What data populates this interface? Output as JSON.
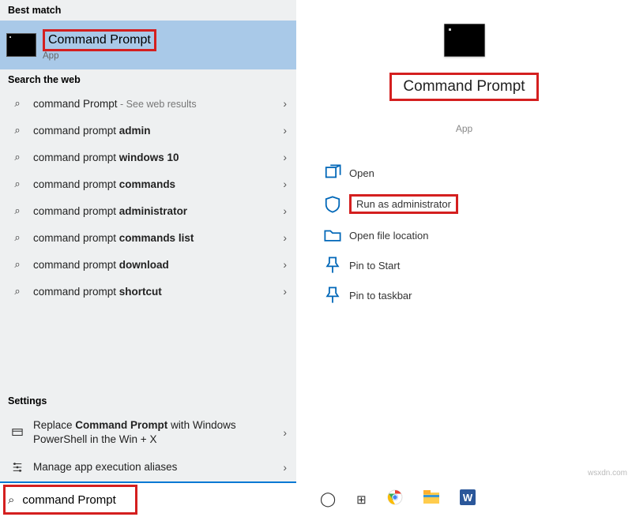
{
  "left": {
    "best_match_header": "Best match",
    "best_match": {
      "title": "Command Prompt",
      "subtitle": "App"
    },
    "web_header": "Search the web",
    "web": [
      {
        "pre": "command Prompt",
        "bold": "",
        "post": "",
        "hint": " - See web results"
      },
      {
        "pre": "command prompt ",
        "bold": "admin",
        "post": "",
        "hint": ""
      },
      {
        "pre": "command prompt ",
        "bold": "windows 10",
        "post": "",
        "hint": ""
      },
      {
        "pre": "command prompt ",
        "bold": "commands",
        "post": "",
        "hint": ""
      },
      {
        "pre": "command prompt ",
        "bold": "administrator",
        "post": "",
        "hint": ""
      },
      {
        "pre": "command prompt ",
        "bold": "commands list",
        "post": "",
        "hint": ""
      },
      {
        "pre": "command prompt ",
        "bold": "download",
        "post": "",
        "hint": ""
      },
      {
        "pre": "command prompt ",
        "bold": "shortcut",
        "post": "",
        "hint": ""
      }
    ],
    "settings_header": "Settings",
    "settings": [
      {
        "pre": "Replace ",
        "bold": "Command Prompt",
        "post": " with Windows PowerShell in the Win + X"
      },
      {
        "pre": "Manage app execution aliases",
        "bold": "",
        "post": ""
      }
    ]
  },
  "right": {
    "title": "Command Prompt",
    "subtitle": "App",
    "actions": {
      "open": "Open",
      "run_admin": "Run as administrator",
      "open_loc": "Open file location",
      "pin_start": "Pin to Start",
      "pin_taskbar": "Pin to taskbar"
    }
  },
  "search_value": "command Prompt",
  "watermark": "wsxdn.com"
}
